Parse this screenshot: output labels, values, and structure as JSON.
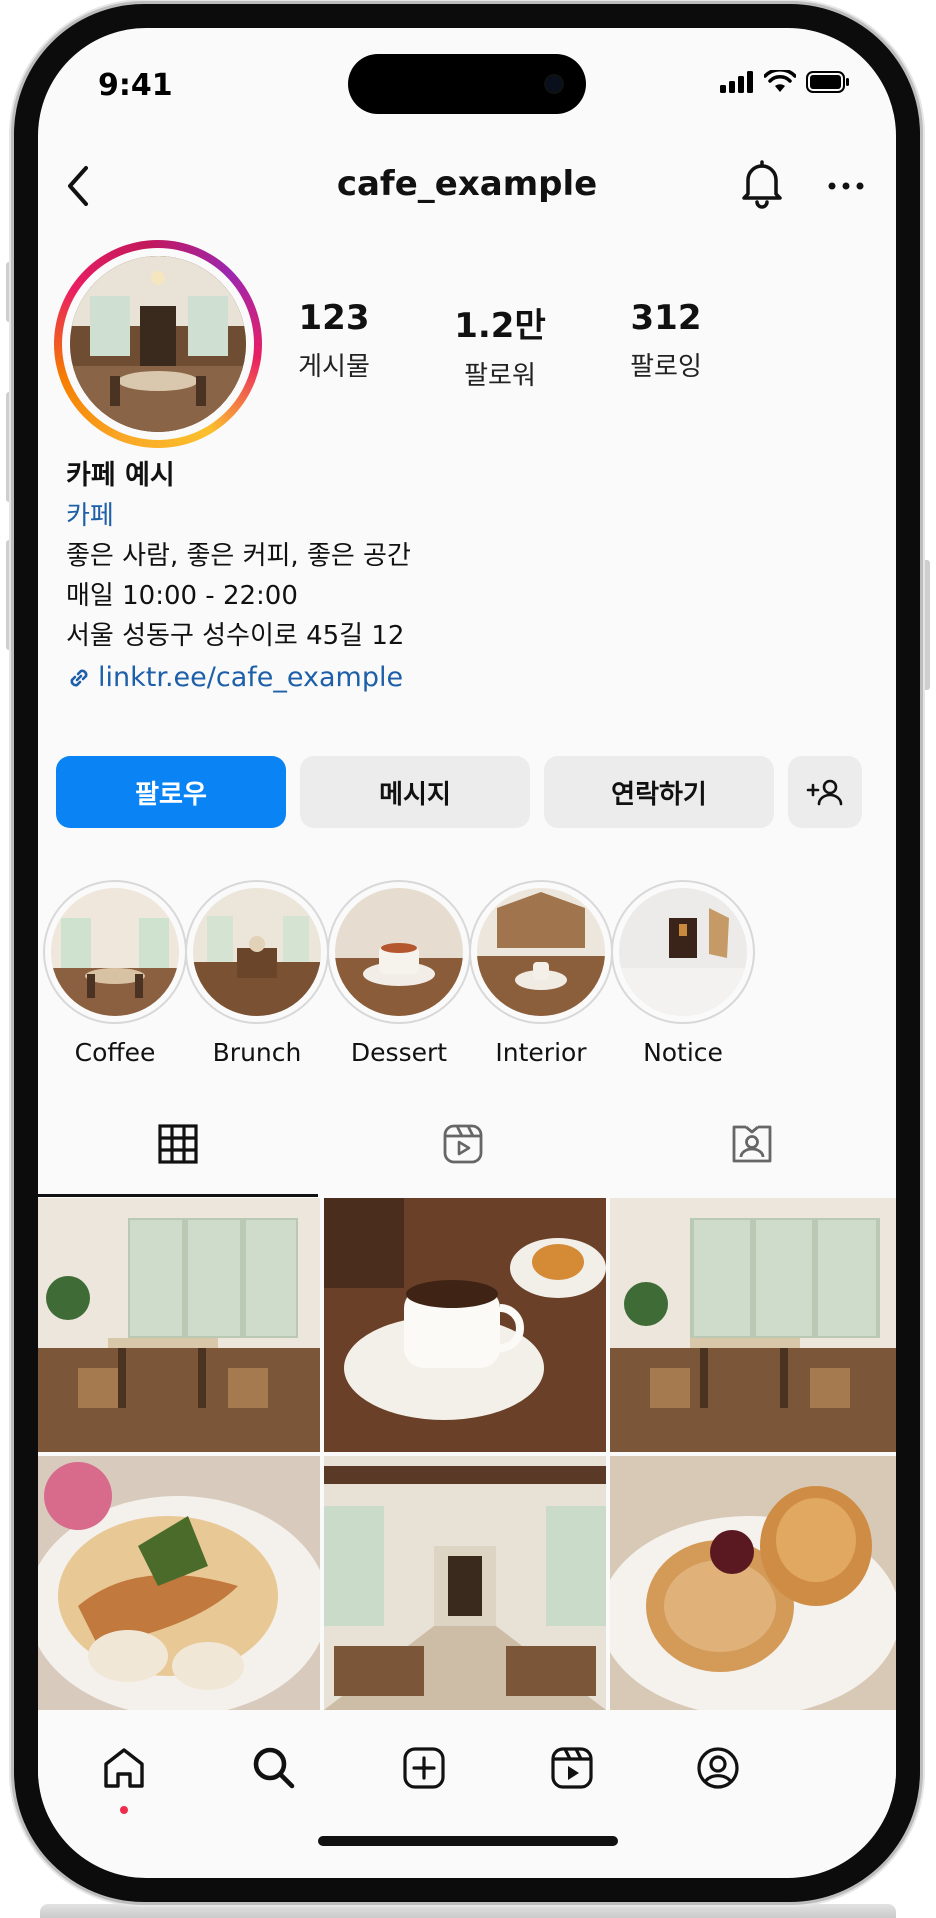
{
  "status_bar": {
    "time": "9:41"
  },
  "header": {
    "title": "cafe_example"
  },
  "profile": {
    "stats": [
      {
        "value": "123",
        "label": "게시물"
      },
      {
        "value": "1.2만",
        "label": "팔로워"
      },
      {
        "value": "312",
        "label": "팔로잉"
      }
    ],
    "name": "카페 예시",
    "category": "카페",
    "bio_lines": [
      "좋은 사람, 좋은 커피, 좋은 공간",
      "매일 10:00 - 22:00",
      "서울 성동구 성수이로 45길 12"
    ],
    "link": "linktr.ee/cafe_example"
  },
  "actions": {
    "follow": "팔로우",
    "message": "메시지",
    "contact": "연락하기"
  },
  "highlights": [
    {
      "label": "Coffee"
    },
    {
      "label": "Brunch"
    },
    {
      "label": "Dessert"
    },
    {
      "label": "Interior"
    },
    {
      "label": "Notice"
    }
  ],
  "tabs": {
    "active": "grid",
    "items": [
      "grid-icon",
      "reels-icon",
      "tagged-icon"
    ]
  },
  "grid_posts": [
    "cafe interior with windows",
    "coffee cup with pastry",
    "cafe interior with windows",
    "pasta dish",
    "long cafe hall",
    "pastry with cherry"
  ],
  "bottom_nav": [
    "home-icon",
    "search-icon",
    "create-icon",
    "reels-icon",
    "profile-icon"
  ],
  "colors": {
    "accent": "#0a84f4",
    "link": "#1d5fa8",
    "notification_dot": "#ee2d4b"
  }
}
